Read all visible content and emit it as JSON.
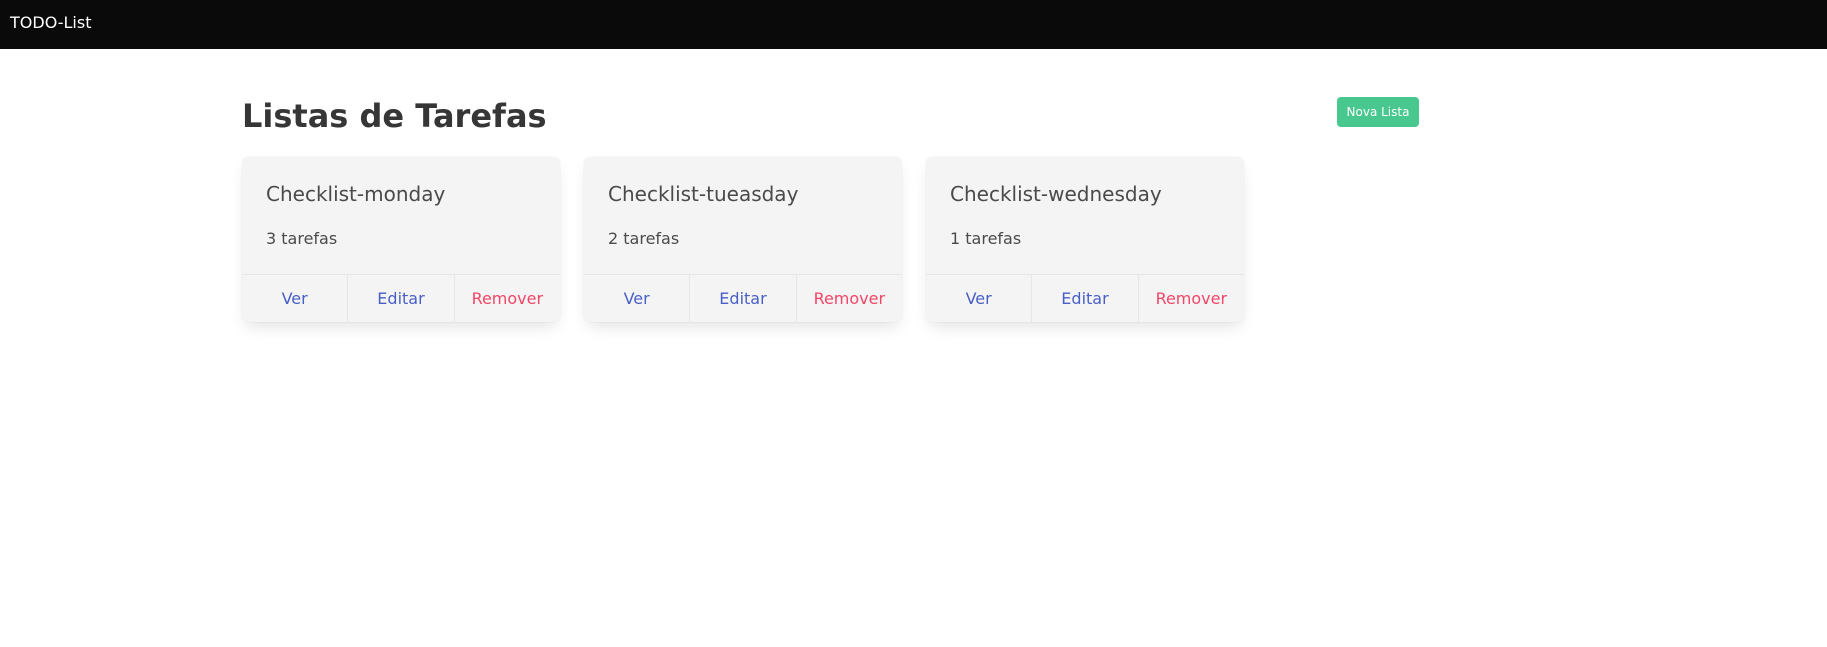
{
  "navbar": {
    "brand": "TODO-List"
  },
  "main": {
    "title": "Listas de Tarefas",
    "new_list_label": "Nova Lista",
    "lists": [
      {
        "name": "Checklist-monday",
        "count": "3 tarefas",
        "actions": {
          "view": "Ver",
          "edit": "Editar",
          "remove": "Remover"
        }
      },
      {
        "name": "Checklist-tueasday",
        "count": "2 tarefas",
        "actions": {
          "view": "Ver",
          "edit": "Editar",
          "remove": "Remover"
        }
      },
      {
        "name": "Checklist-wednesday",
        "count": "1 tarefas",
        "actions": {
          "view": "Ver",
          "edit": "Editar",
          "remove": "Remover"
        }
      }
    ]
  },
  "colors": {
    "navbar_bg": "#0a0a0a",
    "success": "#48c78e",
    "link": "#485fc7",
    "danger": "#f14668",
    "card_bg": "#f4f4f4"
  }
}
